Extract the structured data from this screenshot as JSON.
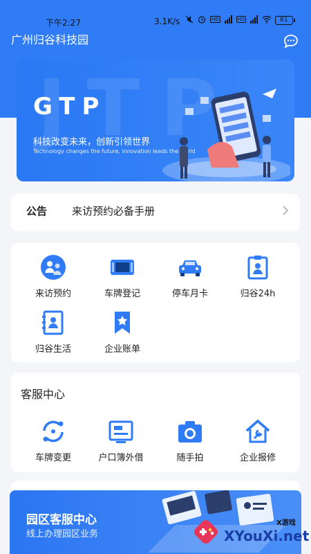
{
  "status_bar": {
    "time": "下午2:27",
    "net_speed": "3.1K/s",
    "battery": "61"
  },
  "header": {
    "title": "广州归谷科技园",
    "message_icon": "chat-bubble-icon"
  },
  "banner": {
    "brand": "GTP",
    "slogan": "科技改变未来，创新引领世界",
    "slogan_en": "Technology changes the future, innovation leads the world"
  },
  "notice": {
    "tag": "公告",
    "text": "来访预约必备手册"
  },
  "services": [
    {
      "label": "来访预约",
      "icon": "visitor-icon"
    },
    {
      "label": "车牌登记",
      "icon": "license-plate-icon"
    },
    {
      "label": "停车月卡",
      "icon": "car-icon"
    },
    {
      "label": "归谷24h",
      "icon": "badge-icon"
    },
    {
      "label": "归谷生活",
      "icon": "contacts-book-icon"
    },
    {
      "label": "企业账单",
      "icon": "bookmark-star-icon"
    }
  ],
  "customer_service": {
    "title": "客服中心",
    "items": [
      {
        "label": "车牌变更",
        "icon": "exchange-icon"
      },
      {
        "label": "户口簿外借",
        "icon": "document-card-icon"
      },
      {
        "label": "随手拍",
        "icon": "camera-icon"
      },
      {
        "label": "企业报修",
        "icon": "house-repair-icon"
      }
    ]
  },
  "promo": {
    "title": "园区客服中心",
    "subtitle": "线上办理园区业务"
  },
  "watermark": {
    "sub": "X游戏",
    "main": "XYouXi.net"
  },
  "colors": {
    "primary": "#2f7cf6",
    "background": "#f3f5f9",
    "card": "#ffffff"
  }
}
